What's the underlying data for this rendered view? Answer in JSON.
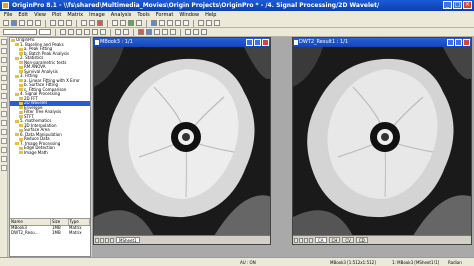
{
  "app": {
    "title": "OriginPro 8.1 - \\\\fs\\shared\\Multimedia_Movies\\Origin Projects\\OriginPro * - /4. Signal Processing/2D Wavelet/"
  },
  "menu": [
    "File",
    "Edit",
    "View",
    "Plot",
    "Matrix",
    "Image",
    "Analysis",
    "Tools",
    "Format",
    "Window",
    "Help"
  ],
  "project_tree": [
    {
      "label": "OriginPro",
      "indent": 0,
      "selected": false
    },
    {
      "label": "1. Baseline and Peaks",
      "indent": 1,
      "selected": false
    },
    {
      "label": "a. Peak Fitting",
      "indent": 2,
      "selected": false
    },
    {
      "label": "b. Batch Peak Analysis",
      "indent": 2,
      "selected": false
    },
    {
      "label": "2. Statistics",
      "indent": 1,
      "selected": false
    },
    {
      "label": "Non-parametric tests",
      "indent": 2,
      "selected": false
    },
    {
      "label": "RM ANOVA",
      "indent": 2,
      "selected": false
    },
    {
      "label": "Survival Analysis",
      "indent": 2,
      "selected": false
    },
    {
      "label": "3. Fitting",
      "indent": 1,
      "selected": false
    },
    {
      "label": "a. Linear Fitting with X Error",
      "indent": 2,
      "selected": false
    },
    {
      "label": "b. Surface Fitting",
      "indent": 2,
      "selected": false
    },
    {
      "label": "c. Fitting Comparison",
      "indent": 2,
      "selected": false
    },
    {
      "label": "4. Signal Processing",
      "indent": 1,
      "selected": false
    },
    {
      "label": "2D FFT",
      "indent": 2,
      "selected": false
    },
    {
      "label": "2D Wavelet",
      "indent": 2,
      "selected": true
    },
    {
      "label": "Envelope",
      "indent": 2,
      "selected": false
    },
    {
      "label": "Filter Tree Analysis",
      "indent": 2,
      "selected": false
    },
    {
      "label": "STFT",
      "indent": 2,
      "selected": false
    },
    {
      "label": "5. mathematics",
      "indent": 1,
      "selected": false
    },
    {
      "label": "3D Interpolation",
      "indent": 2,
      "selected": false
    },
    {
      "label": "Surface Area",
      "indent": 2,
      "selected": false
    },
    {
      "label": "6. Data Manipulation",
      "indent": 1,
      "selected": false
    },
    {
      "label": "Reduce Data",
      "indent": 2,
      "selected": false
    },
    {
      "label": "7. Image Processing",
      "indent": 1,
      "selected": false
    },
    {
      "label": "Edge Detection",
      "indent": 2,
      "selected": false
    },
    {
      "label": "Image Math",
      "indent": 2,
      "selected": false
    }
  ],
  "file_list": {
    "headers": [
      "Name",
      "Size",
      "Type"
    ],
    "rows": [
      {
        "name": "MBook3",
        "size": "1MB",
        "type": "Matrix"
      },
      {
        "name": "DWT2_Resu...",
        "size": "1MB",
        "type": "Matrix"
      }
    ]
  },
  "windows": [
    {
      "title": "MBook3 : 1/1",
      "sheet_tab": "MSheet1"
    },
    {
      "title": "DWT2_Result1 : 1/1",
      "sheet_tab": "CA",
      "extra_tabs": [
        "CH",
        "CV",
        "CD"
      ]
    }
  ],
  "status": {
    "left": "AU : ON",
    "middle": "MBook3 [1:512x1:512]",
    "right": "1: MBook3 [MSheet1!1]",
    "angle": "Radian"
  },
  "colors": {
    "title_bar": "#0a3fb0",
    "selected": "#2a5bd7",
    "mdi_background": "#a9a9a9"
  }
}
